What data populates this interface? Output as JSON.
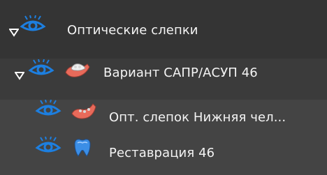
{
  "tree": {
    "items": [
      {
        "label": "Оптические слепки",
        "expanded": true,
        "icon": "optical-scans-group-icon"
      },
      {
        "label": "Вариант САПР/АСУП 46",
        "expanded": true,
        "icon": "jaw-model-icon"
      },
      {
        "label": "Опт. слепок Нижняя чел...",
        "icon": "lower-jaw-scan-icon"
      },
      {
        "label": "Реставрация 46",
        "icon": "tooth-restoration-icon"
      }
    ]
  },
  "colors": {
    "eye_icon": "#1d7fe0",
    "jaw_pink": "#e86a5a",
    "tooth_blue": "#3b8ee6",
    "background": "#313131"
  }
}
